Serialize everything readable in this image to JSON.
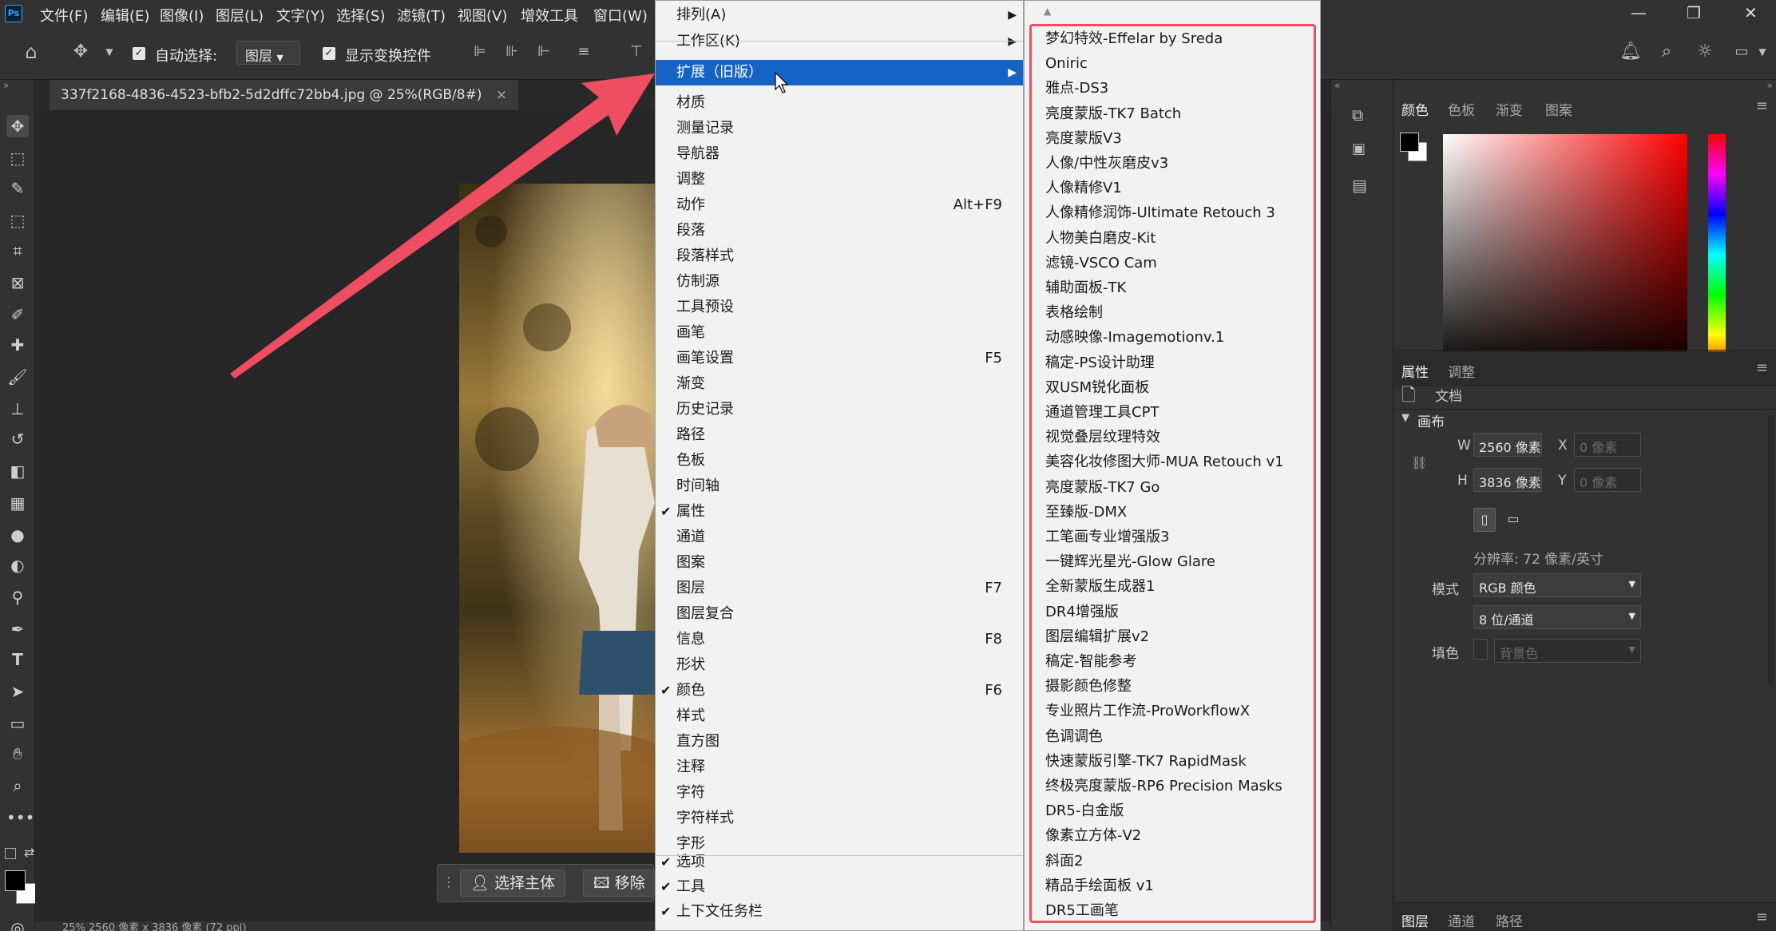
{
  "menubar": {
    "logo": "Ps",
    "items": [
      "文件(F)",
      "编辑(E)",
      "图像(I)",
      "图层(L)",
      "文字(Y)",
      "选择(S)",
      "滤镜(T)",
      "视图(V)",
      "增效工具",
      "窗口(W)"
    ],
    "window_controls": {
      "minimize": "—",
      "restore": "❐",
      "close": "✕"
    }
  },
  "options": {
    "auto_select_label": "自动选择:",
    "auto_select_target": "图层",
    "show_transform_label": "显示变换控件"
  },
  "document": {
    "tab_title": "337f2168-4836-4523-bfb2-5d2dffc72bb4.jpg @ 25%(RGB/8#)",
    "tab_close": "×",
    "status": "25%    2560 像素 x 3836 像素 (72 ppi)"
  },
  "select_bar": {
    "select_subject": "选择主体",
    "remove": "移除"
  },
  "window_menu": {
    "items": [
      {
        "label": "排列(A)",
        "submenu": true
      },
      {
        "label": "工作区(K)",
        "submenu": true
      },
      {
        "label": "扩展（旧版）",
        "submenu": true,
        "highlighted": true
      },
      {
        "label": "材质"
      },
      {
        "label": "测量记录"
      },
      {
        "label": "导航器"
      },
      {
        "label": "调整"
      },
      {
        "label": "动作",
        "shortcut": "Alt+F9"
      },
      {
        "label": "段落"
      },
      {
        "label": "段落样式"
      },
      {
        "label": "仿制源"
      },
      {
        "label": "工具预设"
      },
      {
        "label": "画笔"
      },
      {
        "label": "画笔设置",
        "shortcut": "F5"
      },
      {
        "label": "渐变"
      },
      {
        "label": "历史记录"
      },
      {
        "label": "路径"
      },
      {
        "label": "色板"
      },
      {
        "label": "时间轴"
      },
      {
        "label": "属性",
        "checked": true
      },
      {
        "label": "通道"
      },
      {
        "label": "图案"
      },
      {
        "label": "图层",
        "shortcut": "F7"
      },
      {
        "label": "图层复合"
      },
      {
        "label": "信息",
        "shortcut": "F8"
      },
      {
        "label": "形状"
      },
      {
        "label": "颜色",
        "checked": true,
        "shortcut": "F6"
      },
      {
        "label": "样式"
      },
      {
        "label": "直方图"
      },
      {
        "label": "注释"
      },
      {
        "label": "字符"
      },
      {
        "label": "字符样式"
      },
      {
        "label": "字形"
      },
      {
        "label": "选项",
        "checked": true
      },
      {
        "label": "工具",
        "checked": true
      },
      {
        "label": "上下文任务栏",
        "checked": true
      }
    ]
  },
  "extensions_menu": {
    "items": [
      "梦幻特效-Effelar by Sreda",
      "Oniric",
      "雅点-DS3",
      "亮度蒙版-TK7 Batch",
      "亮度蒙版V3",
      "人像/中性灰磨皮v3",
      "人像精修V1",
      "人像精修润饰-Ultimate Retouch 3",
      "人物美白磨皮-Kit",
      "滤镜-VSCO Cam",
      "辅助面板-TK",
      "表格绘制",
      "动感映像-Imagemotionv.1",
      "稿定-PS设计助理",
      "双USM锐化面板",
      "通道管理工具CPT",
      "视觉叠层纹理特效",
      "美容化妆修图大师-MUA Retouch v1",
      "亮度蒙版-TK7 Go",
      "至臻版-DMX",
      "工笔画专业增强版3",
      "一键辉光星光-Glow Glare",
      "全新蒙版生成器1",
      "DR4增强版",
      "图层编辑扩展v2",
      "稿定-智能参考",
      "摄影颜色修整",
      "专业照片工作流-ProWorkflowX",
      "色调调色",
      "快速蒙版引擎-TK7 RapidMask",
      "终极亮度蒙版-RP6 Precision Masks",
      "DR5-白金版",
      "像素立方体-V2",
      "斜面2",
      "精品手绘面板 v1",
      "DR5工画笔"
    ]
  },
  "color_panel": {
    "tabs": [
      "颜色",
      "色板",
      "渐变",
      "图案"
    ],
    "accent_red": "#ff0000"
  },
  "properties_panel": {
    "tabs": [
      "属性",
      "调整"
    ],
    "doc_label": "文档",
    "canvas_section": "画布",
    "w_label": "W",
    "w_value": "2560 像素",
    "h_label": "H",
    "h_value": "3836 像素",
    "x_label": "X",
    "x_placeholder": "0 像素",
    "y_label": "Y",
    "y_placeholder": "0 像素",
    "resolution": "分辨率: 72 像素/英寸",
    "mode_label": "模式",
    "mode_value": "RGB 颜色",
    "depth_value": "8 位/通道",
    "fill_label": "填色",
    "fill_value": "背景色"
  },
  "layers_panel": {
    "tabs": [
      "图层",
      "通道",
      "路径"
    ]
  },
  "annotation": {
    "arrow_color": "#ef4d61",
    "box_color": "#ef4d61"
  }
}
